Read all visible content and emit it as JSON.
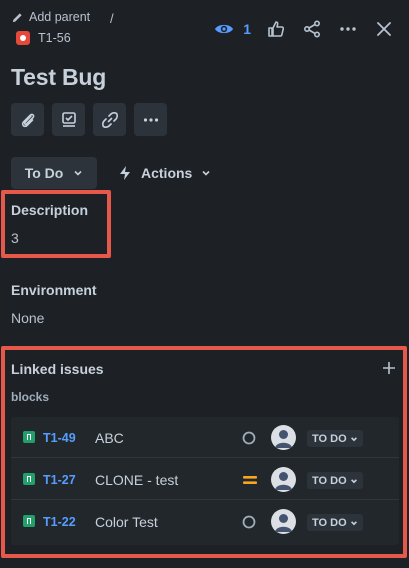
{
  "header": {
    "add_parent": "Add parent",
    "separator": "/",
    "issue_key": "T1-56",
    "watch_count": "1"
  },
  "title": "Test Bug",
  "status_button": "To Do",
  "actions_button": "Actions",
  "description": {
    "label": "Description",
    "value": "3"
  },
  "environment": {
    "label": "Environment",
    "value": "None"
  },
  "linked_issues": {
    "label": "Linked issues",
    "relation": "blocks",
    "items": [
      {
        "key": "T1-49",
        "summary": "ABC",
        "priority": "none",
        "status": "TO DO"
      },
      {
        "key": "T1-27",
        "summary": "CLONE - test",
        "priority": "medium",
        "status": "TO DO"
      },
      {
        "key": "T1-22",
        "summary": "Color Test",
        "priority": "none",
        "status": "TO DO"
      }
    ]
  },
  "colors": {
    "background": "#1d2125",
    "link": "#579dff",
    "bug": "#e5493a",
    "story": "#22a06b",
    "priority_medium": "#f5a623",
    "highlight": "#e5584a"
  }
}
